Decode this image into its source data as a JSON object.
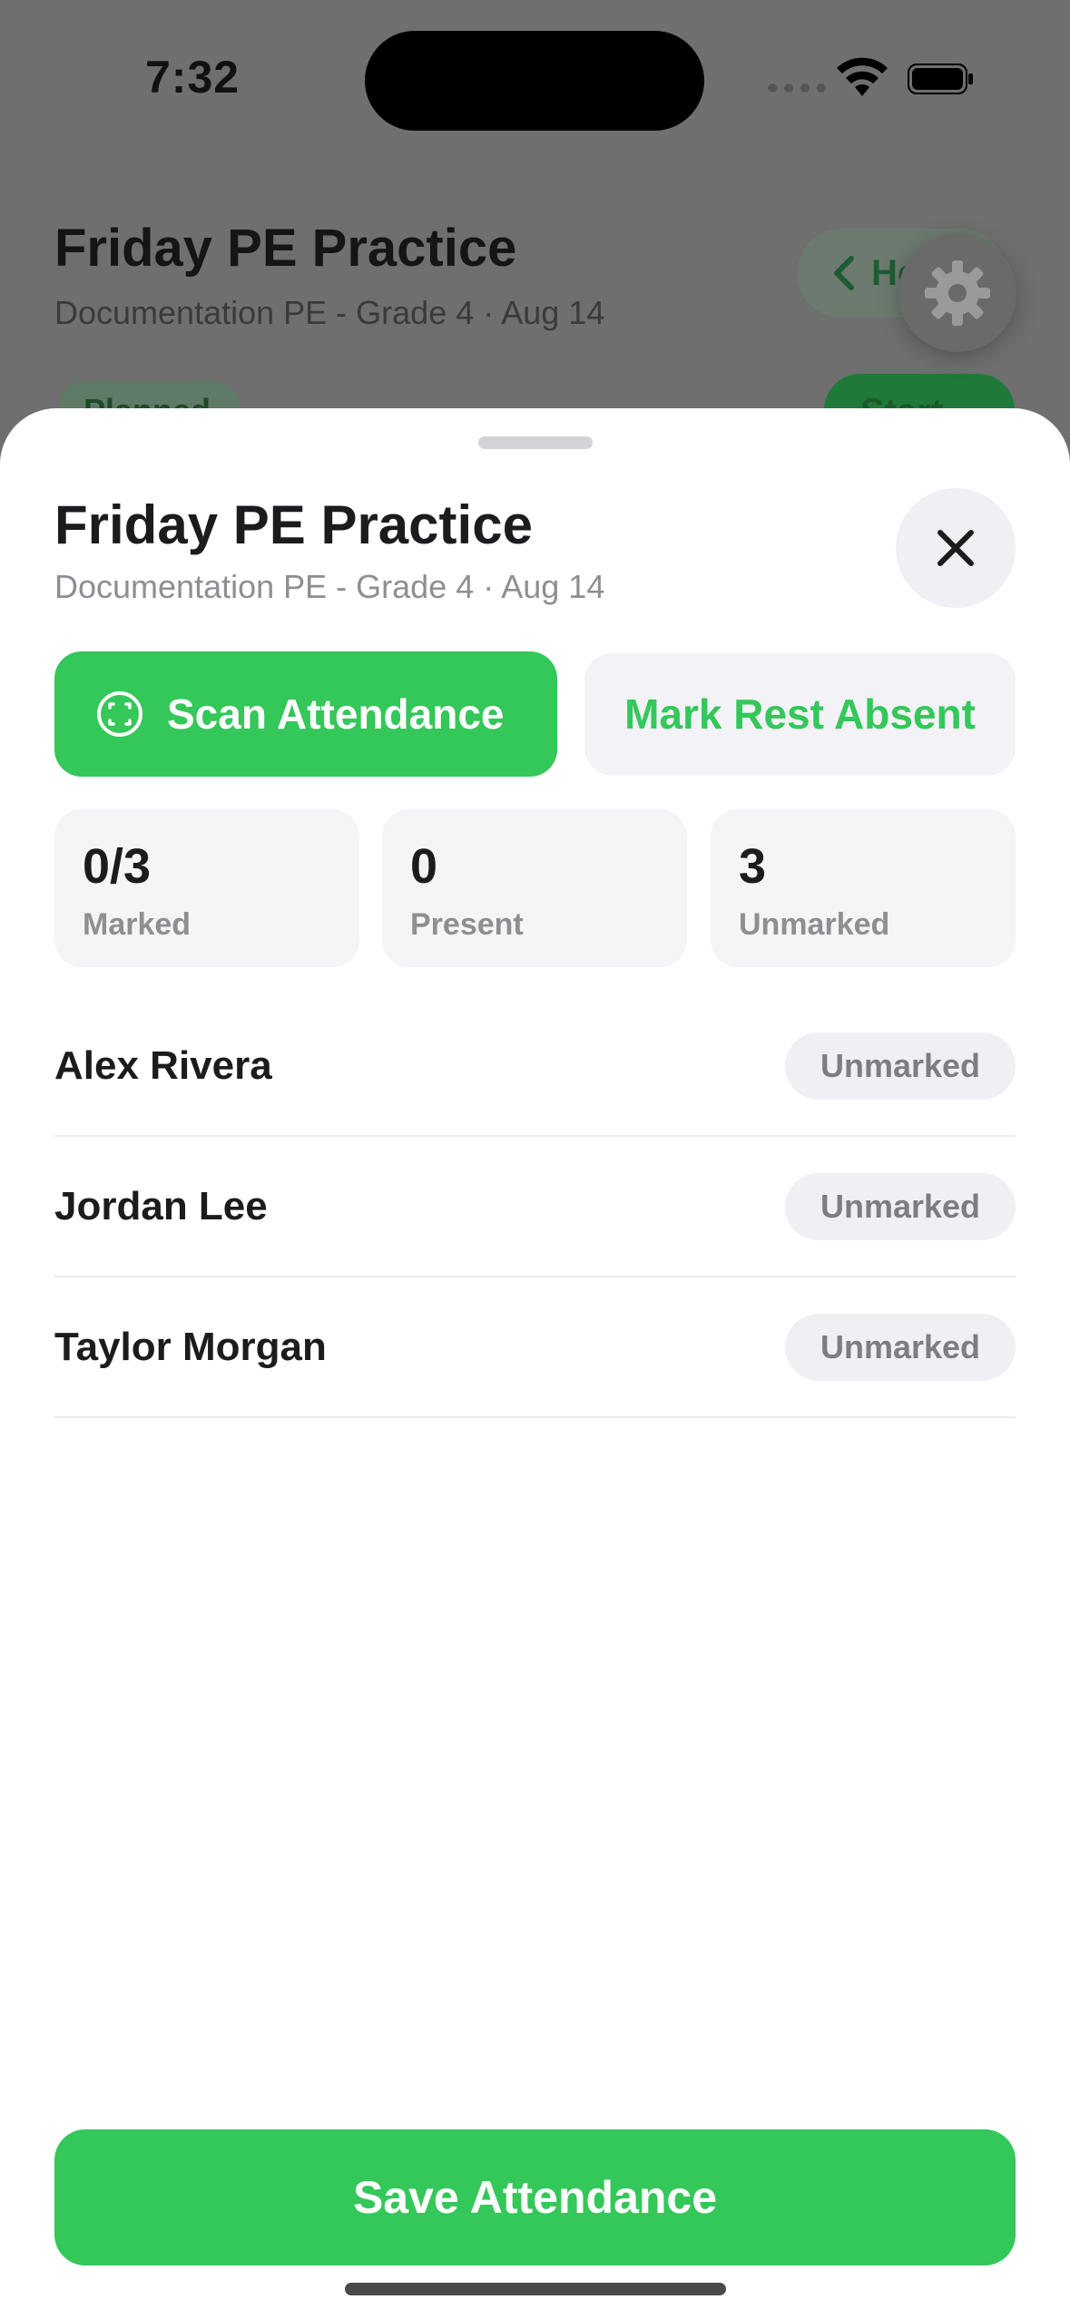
{
  "status_bar": {
    "time": "7:32"
  },
  "background_page": {
    "title": "Friday PE Practice",
    "subtitle": "Documentation PE - Grade 4 · Aug 14",
    "home_label": "Ho",
    "status_badge": "Planned",
    "start_label": "Start"
  },
  "sheet": {
    "title": "Friday PE Practice",
    "subtitle": "Documentation PE - Grade 4 · Aug 14",
    "scan_label": "Scan Attendance",
    "mark_rest_label": "Mark Rest Absent",
    "stats": [
      {
        "value": "0/3",
        "label": "Marked"
      },
      {
        "value": "0",
        "label": "Present"
      },
      {
        "value": "3",
        "label": "Unmarked"
      }
    ],
    "students": [
      {
        "name": "Alex Rivera",
        "status": "Unmarked"
      },
      {
        "name": "Jordan Lee",
        "status": "Unmarked"
      },
      {
        "name": "Taylor Morgan",
        "status": "Unmarked"
      }
    ],
    "save_label": "Save Attendance"
  },
  "colors": {
    "accent": "#34c759",
    "badge_bg": "#f0f0f4",
    "muted_text": "#8e8e93"
  },
  "icons": [
    "wifi-icon",
    "battery-icon",
    "chevron-left-icon",
    "gear-icon",
    "close-icon",
    "scan-face-icon"
  ]
}
